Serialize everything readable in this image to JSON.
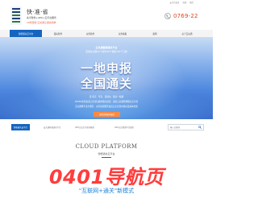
{
  "topbar": {
    "links": [
      "云平台首页",
      "营销",
      "我的"
    ]
  },
  "header": {
    "brand_name": "快·准·省",
    "brand_sub": "先享软件+AEO+云平台服务",
    "brand_tag": "20年经验 云关通让通关简单",
    "phone": "0769-22"
  },
  "nav": {
    "items": [
      {
        "label": "智能通关云平台",
        "active": true
      },
      {
        "label": "报关软件",
        "active": false
      },
      {
        "label": "关务软件",
        "active": false
      },
      {
        "label": "关务看板",
        "active": false
      },
      {
        "label": "案例",
        "active": false
      },
      {
        "label": "关于云关通",
        "active": false
      }
    ]
  },
  "banner": {
    "title": "云关通智能通关平台",
    "subtitle": "应用在全国20个省份40个地区197个口岸",
    "big_line1": "一地申报",
    "big_line2": "全国通关",
    "line1": "直·南京、华东、深圳关、报关一站通",
    "line2": "20000多家进出口企业信赖的报关运营、进出口关通智能报关云平台",
    "line3": "云关通携手多方服务、关务运营服务进出口企业及时通关及成本优化",
    "button": "查看详情更多服务"
  },
  "subnav": {
    "crumbs": [
      "智能通关云平台",
      "云关通智能通关平台",
      "AEO认证关务咨询服务",
      "AEO认证管理平台服务"
    ],
    "search_placeholder": "输入关键词"
  },
  "cloud": {
    "title": "CLOUD PLATFORM",
    "subtitle": "智能通关云平台"
  },
  "error": {
    "code": "0401导航页",
    "sub": "\"互联网+通关\"新模式"
  },
  "colors": {
    "brand_blue": "#1565c0",
    "accent_red": "#e84118",
    "error_red": "#ff3d3d",
    "link_blue": "#1d82d8"
  }
}
